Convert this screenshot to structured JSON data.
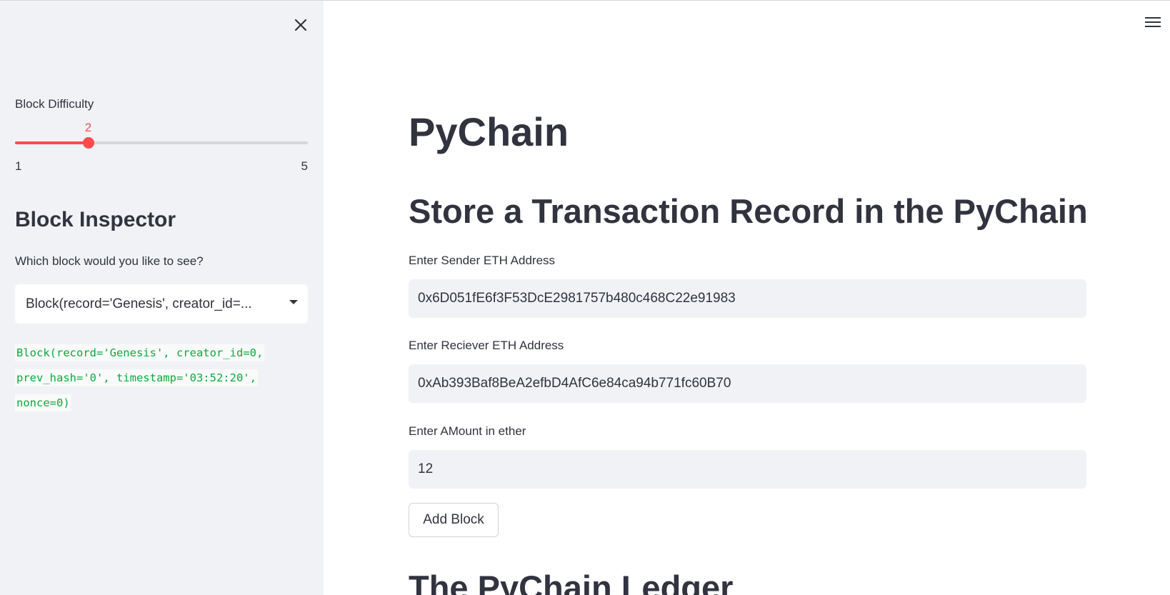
{
  "sidebar": {
    "difficulty_label": "Block Difficulty",
    "difficulty": {
      "value": 2,
      "min": 1,
      "max": 5,
      "value_text": "2",
      "min_text": "1",
      "max_text": "5"
    },
    "inspector_heading": "Block Inspector",
    "block_question": "Which block would you like to see?",
    "block_select_value": "Block(record='Genesis', creator_id=...",
    "block_code_lines": [
      "Block(record='Genesis', creator_id=0,",
      "prev_hash='0', timestamp='03:52:20',",
      "nonce=0)"
    ]
  },
  "main": {
    "title": "PyChain",
    "section_title": "Store a Transaction Record in the PyChain",
    "sender_label": "Enter Sender ETH Address",
    "sender_value": "0x6D051fE6f3F53DcE2981757b480c468C22e91983",
    "receiver_label": "Enter Reciever ETH Address",
    "receiver_value": "0xAb393Baf8BeA2efbD4AfC6e84ca94b771fc60B70",
    "amount_label": "Enter AMount in ether",
    "amount_value": "12",
    "add_block_label": "Add Block",
    "ledger_title": "The PyChain Ledger"
  },
  "icons": {
    "close": "close-icon",
    "menu": "hamburger-menu-icon"
  },
  "colors": {
    "accent": "#ff4b4b",
    "sidebar_bg": "#f0f2f6",
    "code_green": "#09ab3b",
    "text": "#31333f"
  }
}
